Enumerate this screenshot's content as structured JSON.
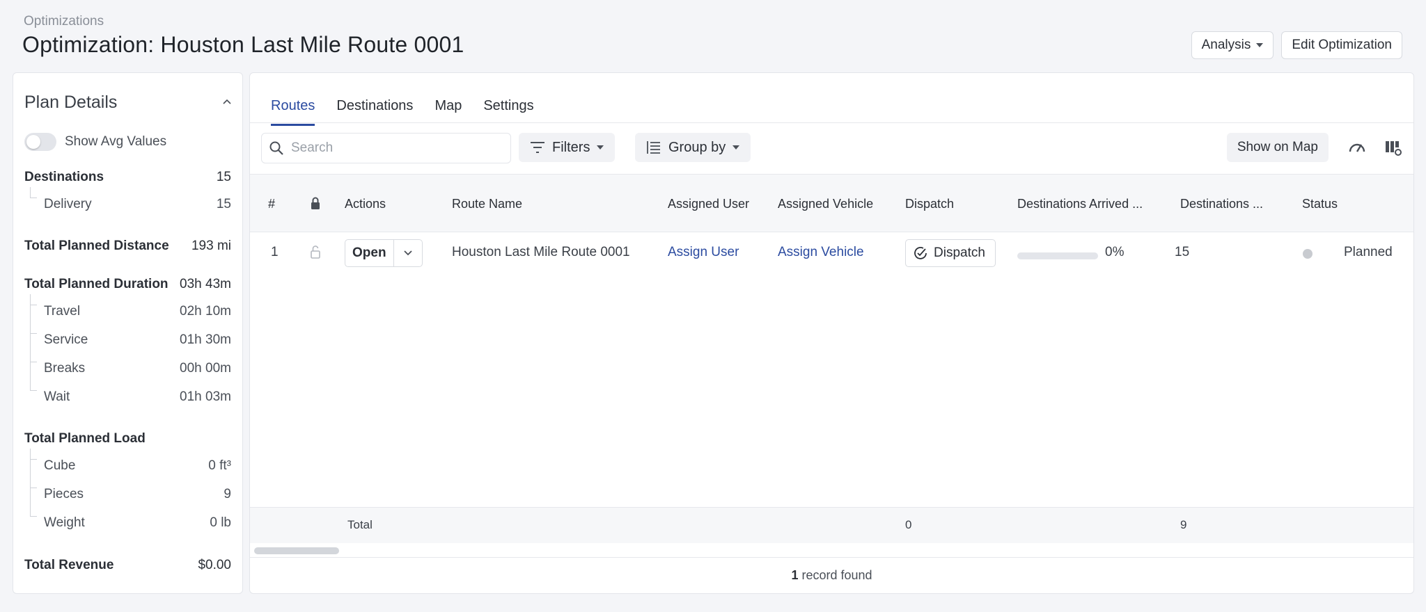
{
  "header": {
    "breadcrumb": "Optimizations",
    "title": "Optimization: Houston Last Mile Route 0001",
    "analysis_label": "Analysis",
    "edit_label": "Edit Optimization"
  },
  "plan": {
    "title": "Plan Details",
    "toggle_label": "Show Avg Values",
    "destinations": {
      "label": "Destinations",
      "value": "15"
    },
    "delivery": {
      "label": "Delivery",
      "value": "15"
    },
    "distance": {
      "label": "Total Planned Distance",
      "value": "193 mi"
    },
    "duration": {
      "label": "Total Planned Duration",
      "value": "03h 43m"
    },
    "travel": {
      "label": "Travel",
      "value": "02h 10m"
    },
    "service": {
      "label": "Service",
      "value": "01h 30m"
    },
    "breaks": {
      "label": "Breaks",
      "value": "00h 00m"
    },
    "wait": {
      "label": "Wait",
      "value": "01h 03m"
    },
    "load": {
      "label": "Total Planned Load"
    },
    "cube": {
      "label": "Cube",
      "value": "0 ft³"
    },
    "pieces": {
      "label": "Pieces",
      "value": "9"
    },
    "weight": {
      "label": "Weight",
      "value": "0 lb"
    },
    "revenue": {
      "label": "Total Revenue",
      "value": "$0.00"
    }
  },
  "tabs": {
    "routes": "Routes",
    "destinations": "Destinations",
    "map": "Map",
    "settings": "Settings"
  },
  "toolbar": {
    "search_placeholder": "Search",
    "filters_label": "Filters",
    "group_by_label": "Group by",
    "show_on_map_label": "Show on Map"
  },
  "table": {
    "headers": {
      "num": "#",
      "actions": "Actions",
      "route_name": "Route Name",
      "assigned_user": "Assigned User",
      "assigned_vehicle": "Assigned Vehicle",
      "dispatch": "Dispatch",
      "dest_arrived": "Destinations Arrived ...",
      "destinations": "Destinations ...",
      "status": "Status"
    },
    "row": {
      "num": "1",
      "action_label": "Open",
      "route_name": "Houston Last Mile Route 0001",
      "assigned_user": "Assign User",
      "assigned_vehicle": "Assign Vehicle",
      "dispatch_label": "Dispatch",
      "progress_text": "0%",
      "progress_fraction": 0,
      "destinations": "15",
      "status": "Planned"
    },
    "footer": {
      "total_label": "Total",
      "dispatch_total": "0",
      "destinations_total": "9"
    }
  },
  "records": {
    "count": "1",
    "suffix": " record found"
  },
  "colors": {
    "accent": "#2b4ba0",
    "status_planned": "#c8cbd0"
  }
}
